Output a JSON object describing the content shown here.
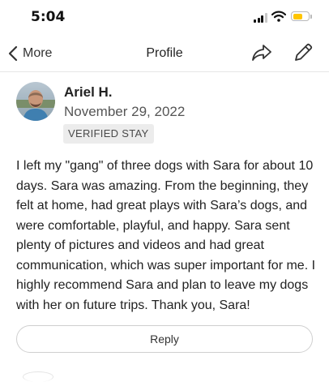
{
  "status_bar": {
    "time": "5:04",
    "battery_color": "#ffc500"
  },
  "nav": {
    "back_label": "More",
    "title": "Profile",
    "icons": [
      "chevron-left-icon",
      "share-icon",
      "pencil-icon"
    ]
  },
  "review": {
    "reviewer_name": "Ariel H.",
    "date": "November 29, 2022",
    "badge": "VERIFIED STAY",
    "text": "I left my \"gang\" of three dogs with Sara for about 10 days. Sara was amazing.  From the beginning, they felt at home, had great plays with Sara’s dogs, and were comfortable, playful, and happy. Sara sent plenty of pictures and videos and had great communication, which was super important for me. I highly recommend Sara and plan to leave my dogs with her on future trips. Thank you, Sara!",
    "reply_label": "Reply"
  }
}
